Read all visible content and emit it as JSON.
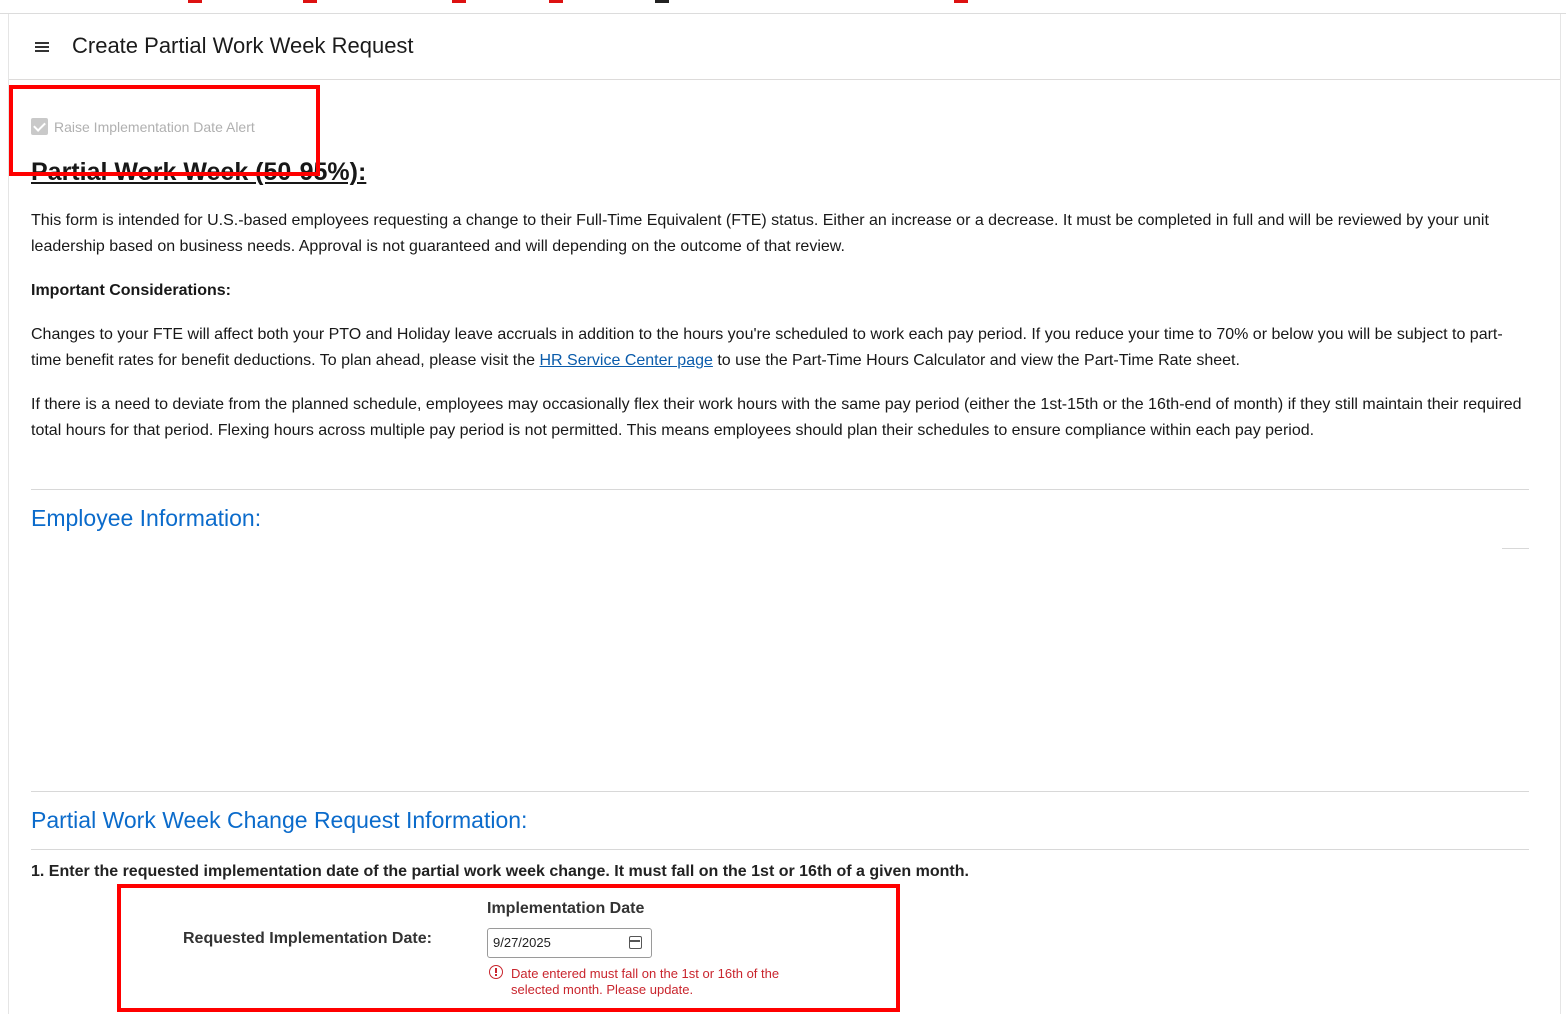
{
  "header": {
    "title": "Create Partial Work Week Request"
  },
  "alert_checkbox": {
    "label": "Raise Implementation Date Alert",
    "checked": true
  },
  "intro": {
    "heading": "Partial Work Week (50-95%):",
    "para1": "This form is intended for U.S.-based employees requesting a change to their Full-Time Equivalent (FTE) status. Either an increase or a decrease. It must be completed in full and will be reviewed by your unit leadership based on business needs. Approval is not guaranteed and will depending on the outcome of that review.",
    "considerations_label": "Important Considerations:",
    "para2_before_link": "Changes to your FTE will affect both your PTO and Holiday leave accruals in addition to the hours you're scheduled to work each pay period. If you reduce your time to 70% or below you will be subject to part-time benefit rates for benefit deductions. To plan ahead, please visit the ",
    "para2_link": "HR Service Center page",
    "para2_after_link": " to use the Part-Time Hours Calculator and view the Part-Time Rate sheet.",
    "para3": "If there is a need to deviate from the planned schedule, employees may occasionally flex their work hours with the same pay period (either the 1st-15th or the 16th-end of month) if they still maintain their required total hours for that period. Flexing hours across multiple pay period is not permitted. This means employees should plan their schedules to ensure compliance within each pay period."
  },
  "employee_section": {
    "heading": "Employee Information:"
  },
  "request_section": {
    "heading": "Partial Work Week Change Request Information:",
    "question1": "1. Enter the requested implementation date of the partial work week change. It must fall on the 1st or 16th of a given month.",
    "field_label": "Requested Implementation Date:",
    "date_caption": "Implementation Date",
    "date_value": "9/27/2025",
    "error_message": "Date entered must fall on the 1st or 16th of the selected month. Please update."
  },
  "colors": {
    "accent_blue": "#0b6bcb",
    "link_blue": "#0b5cab",
    "error_red": "#c9252d",
    "highlight_red": "#ff0000"
  }
}
